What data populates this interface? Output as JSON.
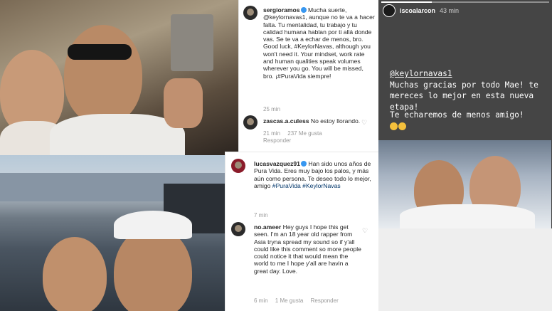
{
  "post_1": {
    "caption_user": "sergioramos",
    "caption_text": "Mucha suerte, @keylornavas1, aunque no te va a hacer falta. Tu mentalidad, tu trabajo y tu calidad humana hablan por ti allá donde vas. Se te va a echar de menos, bro. Good luck, #KeylorNavas, although you won't need it. Your mindset, work rate and human qualities speak volumes wherever you go. You will be missed, bro. ¡#PuraVida siempre!",
    "caption_time": "25 min",
    "reply_user": "zascas.a.culess",
    "reply_text": "No estoy llorando.",
    "reply_time": "21 min",
    "reply_likes": "237 Me gusta",
    "reply_action": "Responder"
  },
  "post_2": {
    "caption_user": "lucasvazquez91",
    "caption_text": "Han sido unos años de Pura Vida. Eres muy bajo los palos, y más aún como persona. Te deseo todo lo mejor, amigo",
    "caption_tags": "#PuraVida #KeylorNavas",
    "caption_time": "7 min",
    "reply_user": "no.ameer",
    "reply_text": "Hey guys I hope this get seen. I'm an 18 year old rapper from Asia tryna spread my sound so if y'all could like this comment so more people could notice it that would mean the world to me I hope y'all are havin a great day. Love.",
    "reply_time": "6 min",
    "reply_likes": "1 Me gusta",
    "reply_action": "Responder"
  },
  "story": {
    "user": "iscoalarcon",
    "time": "43 min",
    "mention": "@keylornavas1",
    "message": "Muchas gracias por todo Mae! te mereces lo mejor en esta nueva etapa!",
    "message_2": "Te echaremos de menos amigo!",
    "progress": 0.3
  }
}
